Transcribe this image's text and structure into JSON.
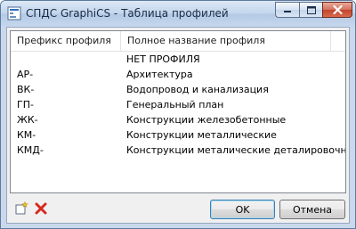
{
  "window": {
    "title": "СПДС GraphiCS - Таблица профилей"
  },
  "table": {
    "columns": [
      "Префикс профиля",
      "Полное название профиля"
    ],
    "rows": [
      {
        "prefix": "",
        "name": "НЕТ ПРОФИЛЯ"
      },
      {
        "prefix": "АР-",
        "name": "Архитектура"
      },
      {
        "prefix": "ВК-",
        "name": "Водопровод и канализация"
      },
      {
        "prefix": "ГП-",
        "name": "Генеральный план"
      },
      {
        "prefix": "ЖК-",
        "name": "Конструкции железобетонные"
      },
      {
        "prefix": "КМ-",
        "name": "Конструкции металлические"
      },
      {
        "prefix": "КМД-",
        "name": "Конструкции металические деталировочные"
      }
    ]
  },
  "buttons": {
    "ok": "OK",
    "cancel": "Отмена"
  },
  "icons": {
    "app": "app-icon",
    "add": "add-profile-icon",
    "delete": "delete-profile-icon"
  }
}
